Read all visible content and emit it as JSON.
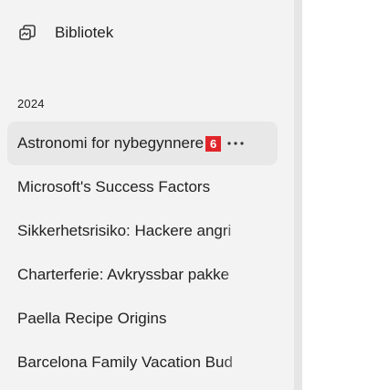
{
  "sidebar": {
    "library": {
      "label": "Bibliotek",
      "icon": "library-icon"
    },
    "section": {
      "title": "2024"
    },
    "items": [
      {
        "title": "Astronomi for nybegynnere",
        "active": true,
        "badge": "6",
        "more_icon": "more-icon"
      },
      {
        "title": "Microsoft's Success Factors",
        "active": false
      },
      {
        "title": "Sikkerhetsrisiko: Hackere angri",
        "active": false
      },
      {
        "title": "Charterferie: Avkryssbar pakke",
        "active": false
      },
      {
        "title": "Paella Recipe Origins",
        "active": false
      },
      {
        "title": "Barcelona Family Vacation Bud",
        "active": false
      }
    ]
  },
  "colors": {
    "sidebar_bg": "#f3f3f3",
    "active_item_bg": "#e8e8e8",
    "divider": "#e6e6e6",
    "badge_bg": "#e0252a",
    "text": "#222222"
  }
}
